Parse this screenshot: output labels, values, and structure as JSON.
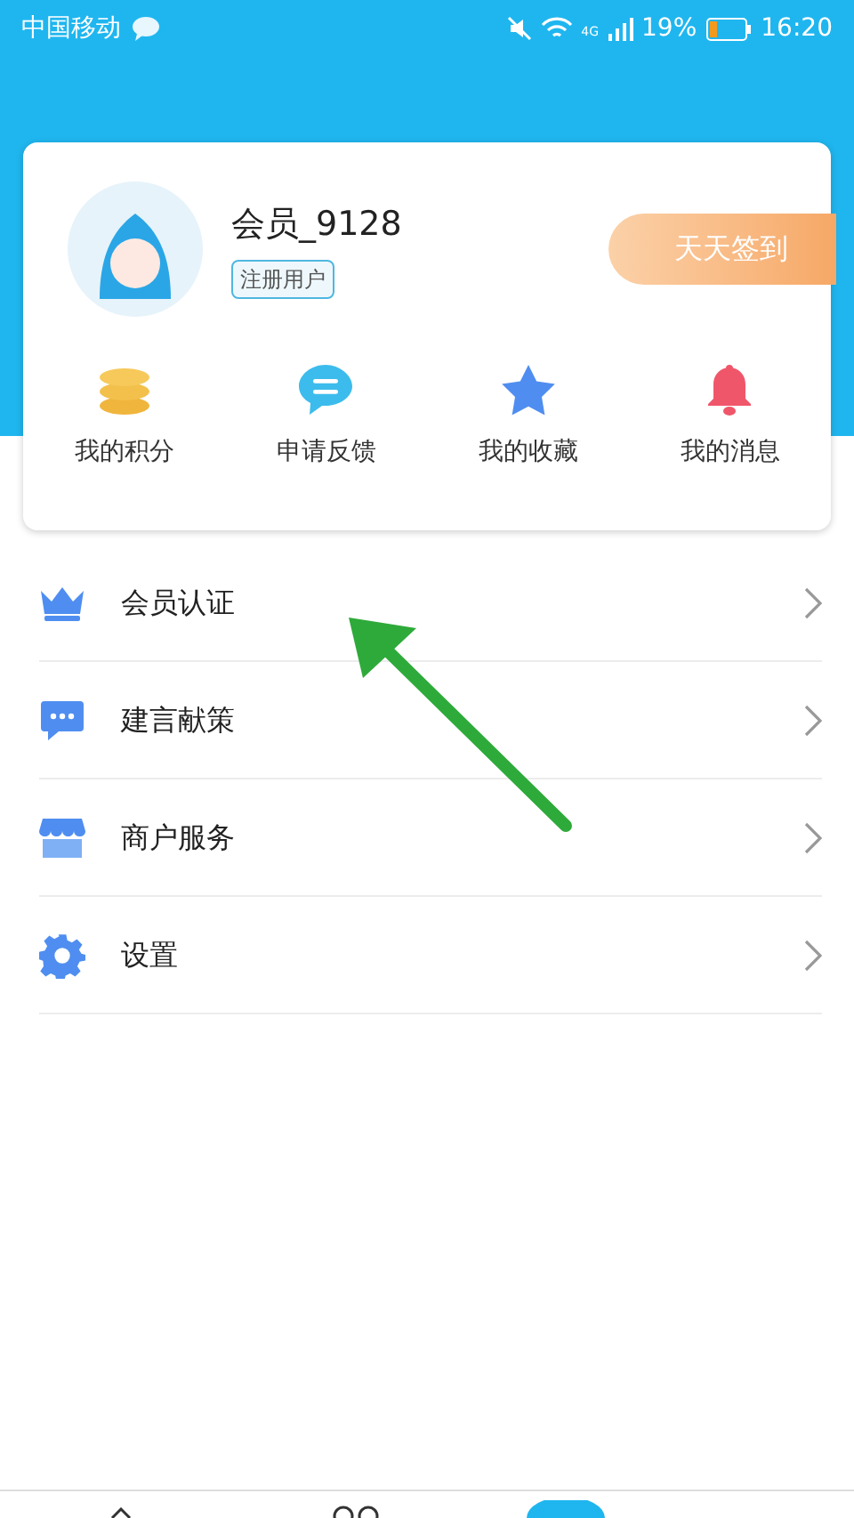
{
  "status_bar": {
    "carrier": "中国移动",
    "network": "4G",
    "battery": "19%",
    "time": "16:20"
  },
  "profile": {
    "name": "会员_9128",
    "tag": "注册用户"
  },
  "checkin_button": "天天签到",
  "shortcuts": [
    {
      "label": "我的积分",
      "kind": "coins"
    },
    {
      "label": "申请反馈",
      "kind": "chat"
    },
    {
      "label": "我的收藏",
      "kind": "star"
    },
    {
      "label": "我的消息",
      "kind": "bell"
    }
  ],
  "menu": [
    {
      "label": "会员认证",
      "kind": "crown"
    },
    {
      "label": "建言献策",
      "kind": "message"
    },
    {
      "label": "商户服务",
      "kind": "shop"
    },
    {
      "label": "设置",
      "kind": "gear"
    }
  ]
}
